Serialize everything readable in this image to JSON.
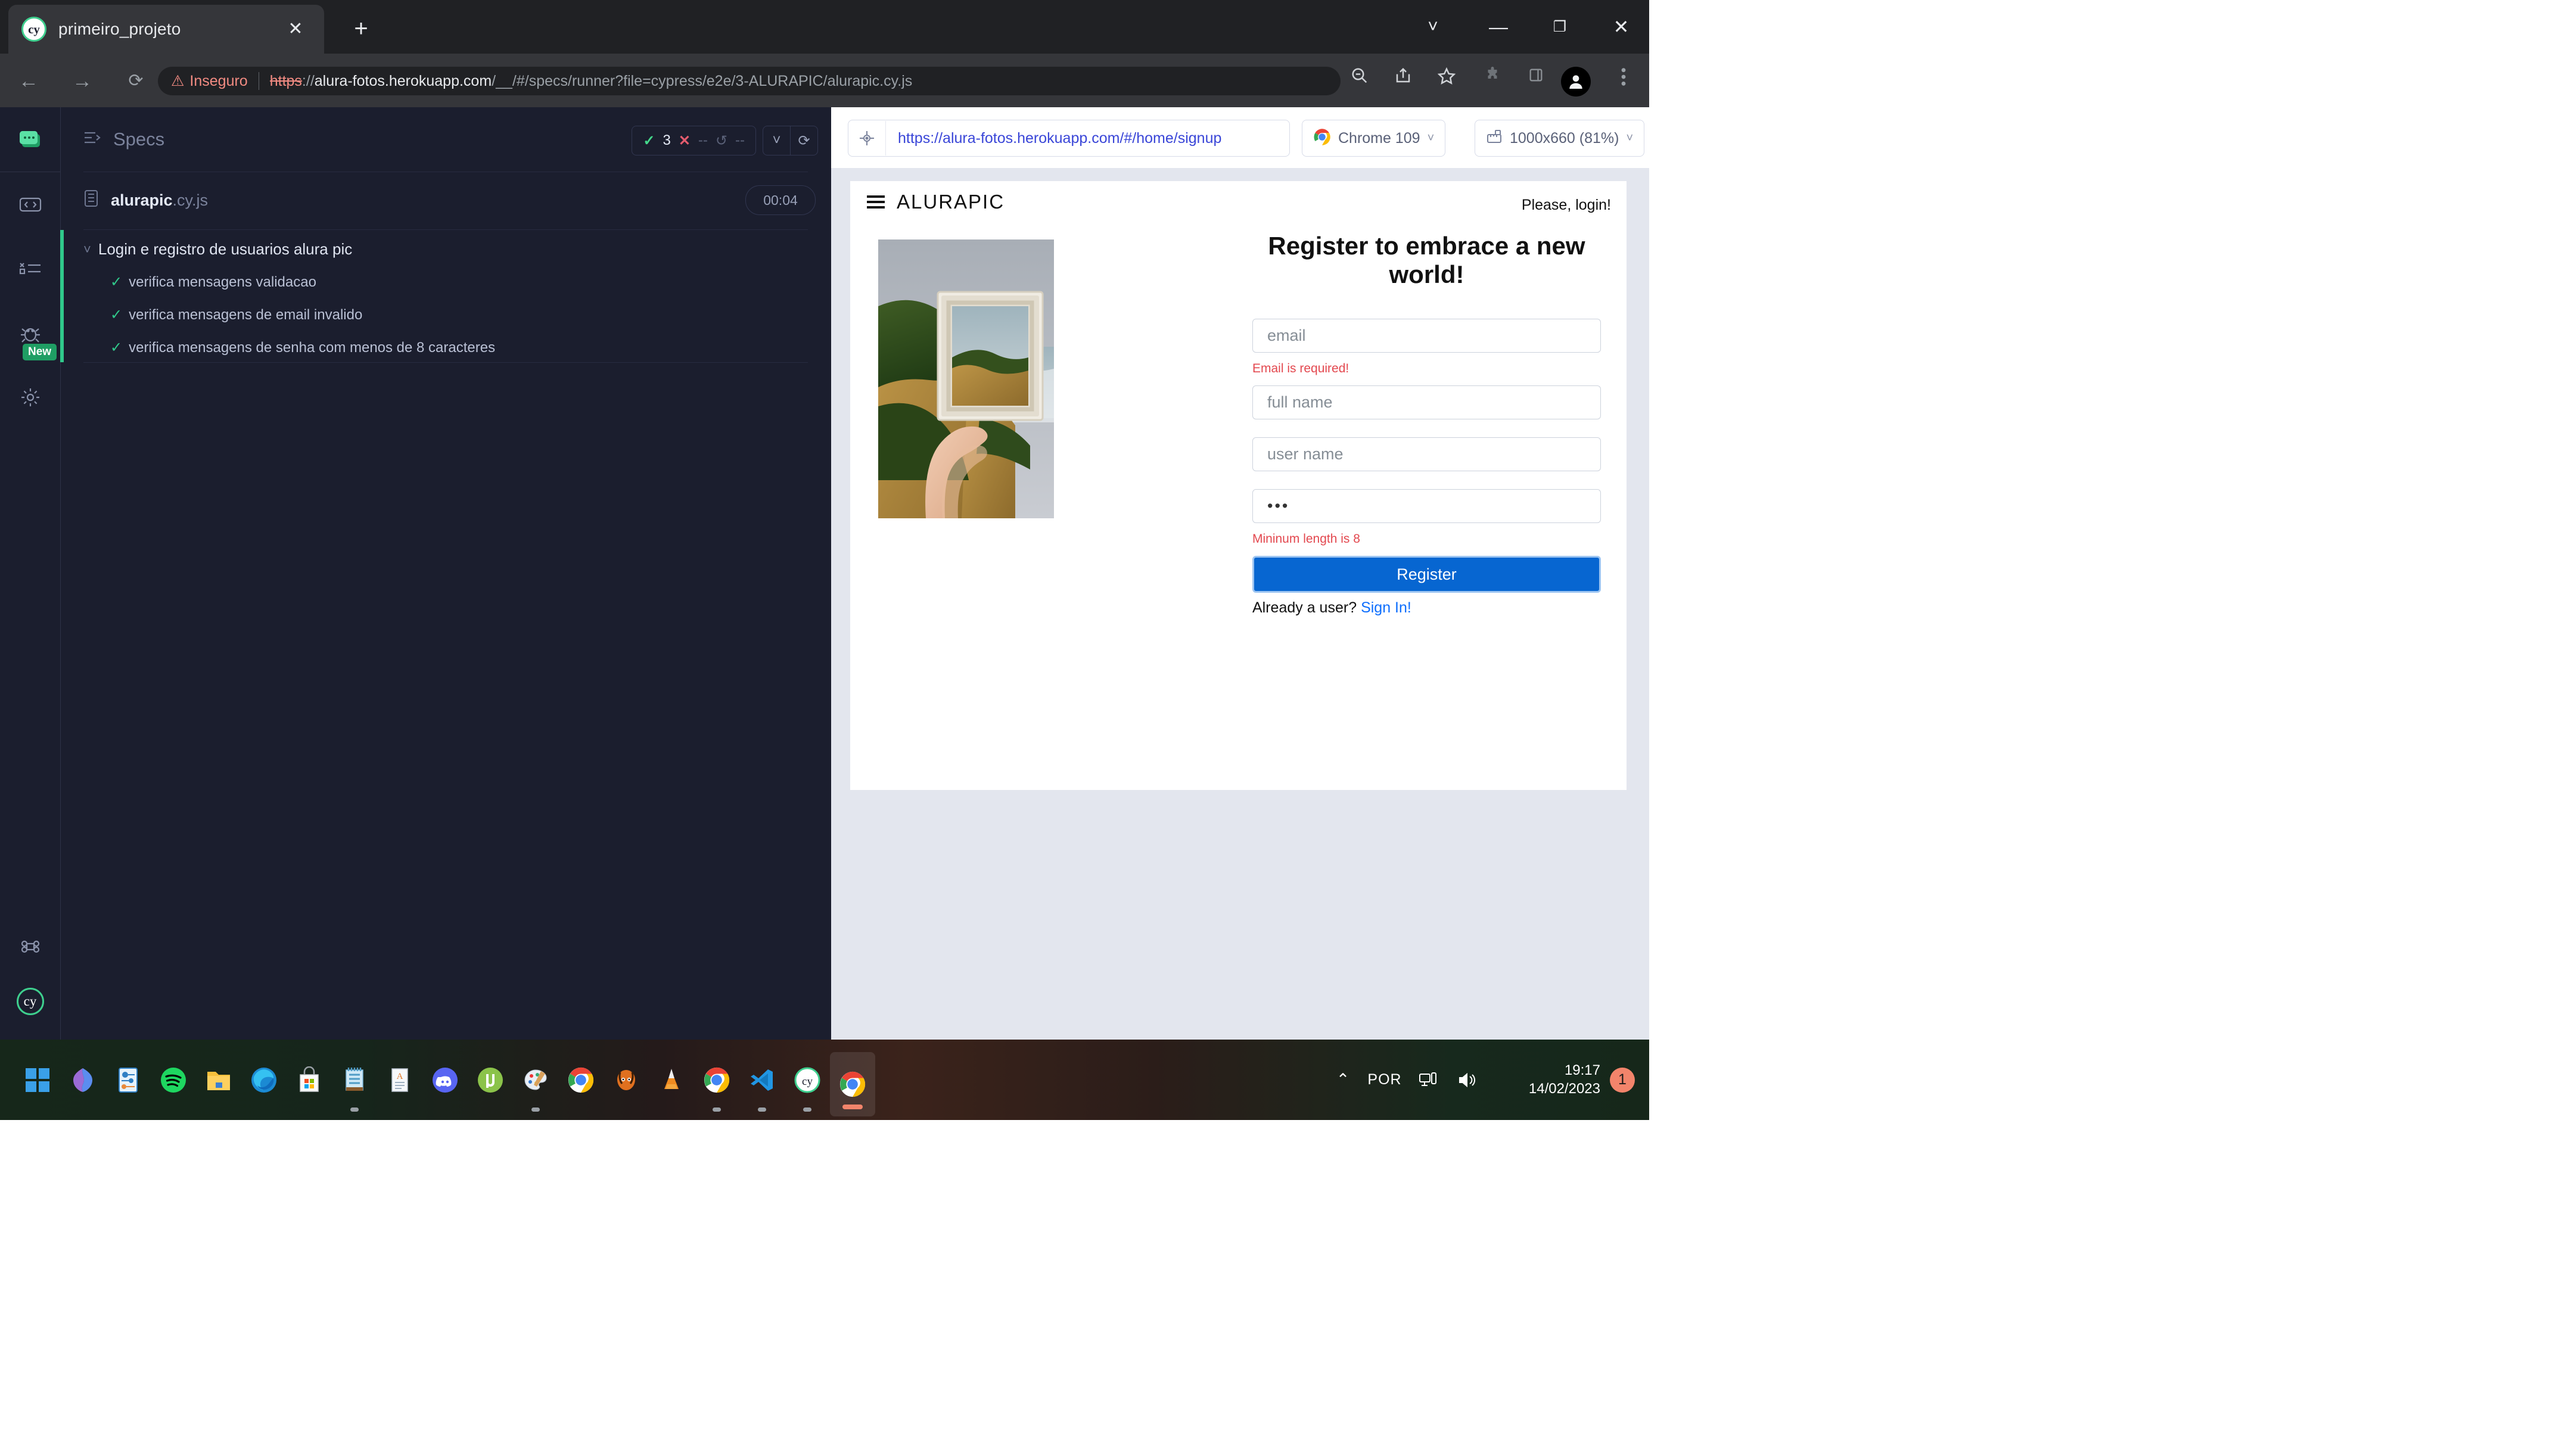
{
  "browser": {
    "tab": {
      "title": "primeiro_projeto",
      "favicon": "cypress-favicon",
      "close_icon": "close-icon"
    },
    "new_tab_icon": "plus-icon",
    "window_controls": {
      "chevron": "chevron-down-icon",
      "minimize": "minimize-icon",
      "maximize": "restore-icon",
      "close": "close-icon"
    },
    "nav": {
      "back": "back-arrow-icon",
      "forward": "forward-arrow-icon",
      "reload": "reload-icon"
    },
    "omnibox": {
      "warning_icon": "warning-triangle-icon",
      "security_label": "Inseguro",
      "url_scheme": "https",
      "url_sep": "://",
      "url_host": "alura-fotos.herokuapp.com",
      "url_path": "/__/#/specs/runner?file=cypress/e2e/3-ALURAPIC/alurapic.cy.js"
    },
    "toolbar_icons": {
      "zoom": "zoom-out-icon",
      "share": "share-icon",
      "star": "bookmark-star-icon",
      "extensions": "puzzle-extensions-icon",
      "sidepanel": "side-panel-icon",
      "profile": "profile-avatar-icon",
      "menu": "three-dot-menu-icon"
    }
  },
  "cypress": {
    "rail": [
      {
        "name": "project-switcher",
        "icon": "cypress-project-icon"
      },
      {
        "name": "specs",
        "icon": "code-window-icon"
      },
      {
        "name": "runs",
        "icon": "runs-list-icon"
      },
      {
        "name": "debug",
        "icon": "bug-icon",
        "badge": "New"
      },
      {
        "name": "settings",
        "icon": "gear-icon"
      },
      {
        "name": "keyboard-shortcuts",
        "icon": "command-key-icon"
      },
      {
        "name": "cypress-logo",
        "icon": "cy-logo-icon",
        "text": "cy"
      }
    ],
    "header": {
      "icon": "specs-list-icon",
      "title": "Specs",
      "stats": {
        "passed_icon": "check-icon",
        "passed": "3",
        "failed_icon": "x-icon",
        "failed": "--",
        "pending_icon": "circle-dash-icon",
        "pending": "--"
      },
      "collapse_icon": "chevron-down-icon",
      "rerun_icon": "reload-circular-icon"
    },
    "spec": {
      "icon": "spec-file-icon",
      "name": "alurapic",
      "extension": ".cy.js",
      "duration": "00:04"
    },
    "results": {
      "suite_chevron": "chevron-down-icon",
      "suite_name": "Login e registro de usuarios alura pic",
      "tests": [
        {
          "status_icon": "check-icon",
          "label": "verifica mensagens validacao"
        },
        {
          "status_icon": "check-icon",
          "label": "verifica mensagens de email invalido"
        },
        {
          "status_icon": "check-icon",
          "label": "verifica mensagens de senha com menos de 8 caracteres"
        }
      ]
    },
    "preview_toolbar": {
      "selector_icon": "element-selector-icon",
      "url": "https://alura-fotos.herokuapp.com/#/home/signup",
      "browser_icon": "chrome-icon",
      "browser_label": "Chrome 109",
      "browser_chevron": "chevron-down-icon",
      "viewport_icon": "viewport-ruler-icon",
      "viewport_label": "1000x660 (81%)",
      "viewport_chevron": "chevron-down-icon"
    }
  },
  "app": {
    "menu_icon": "hamburger-menu-icon",
    "brand": "ALURAPIC",
    "login_prompt": "Please, login!",
    "photo_alt": "hand-holding-picture-frame-photo",
    "form": {
      "title": "Register to embrace a new world!",
      "email": {
        "placeholder": "email",
        "value": "",
        "error": "Email is required!"
      },
      "fullname": {
        "placeholder": "full name",
        "value": ""
      },
      "username": {
        "placeholder": "user name",
        "value": ""
      },
      "password": {
        "placeholder": "",
        "value": "•••",
        "error": "Mininum length is 8"
      },
      "submit_label": "Register",
      "footer_text": "Already a user?",
      "footer_link": "Sign In!"
    }
  },
  "taskbar": {
    "apps": [
      {
        "name": "start-button",
        "icon": "windows-start-icon"
      },
      {
        "name": "copilot",
        "icon": "copilot-icon"
      },
      {
        "name": "settings",
        "icon": "settings-icon"
      },
      {
        "name": "spotify",
        "icon": "spotify-icon"
      },
      {
        "name": "file-explorer",
        "icon": "file-explorer-icon"
      },
      {
        "name": "edge",
        "icon": "edge-icon"
      },
      {
        "name": "microsoft-store",
        "icon": "store-icon"
      },
      {
        "name": "notepad",
        "icon": "notepad-icon"
      },
      {
        "name": "word",
        "icon": "word-icon"
      },
      {
        "name": "discord",
        "icon": "discord-icon"
      },
      {
        "name": "utorrent",
        "icon": "utorrent-icon"
      },
      {
        "name": "paint",
        "icon": "paint-icon"
      },
      {
        "name": "chrome",
        "icon": "chrome-icon"
      },
      {
        "name": "gimp",
        "icon": "gimp-icon"
      },
      {
        "name": "vlc",
        "icon": "vlc-icon"
      },
      {
        "name": "chrome-2",
        "icon": "chrome-icon"
      },
      {
        "name": "vscode",
        "icon": "vscode-icon"
      },
      {
        "name": "cypress",
        "icon": "cypress-icon"
      },
      {
        "name": "chrome-active",
        "icon": "chrome-icon"
      }
    ],
    "tray": {
      "overflow_icon": "chevron-up-icon",
      "language": "POR",
      "network_icon": "network-icon",
      "volume_icon": "volume-icon",
      "time": "19:17",
      "date": "14/02/2023",
      "notification_count": "1"
    }
  },
  "colors": {
    "cypress_green": "#30c98b",
    "cypress_dark": "#1b1e2e",
    "chrome_dark": "#202124",
    "error_red": "#e3484f",
    "primary_blue": "#0766d1",
    "link_blue": "#0d6efd",
    "insecure_red": "#f28b82"
  }
}
